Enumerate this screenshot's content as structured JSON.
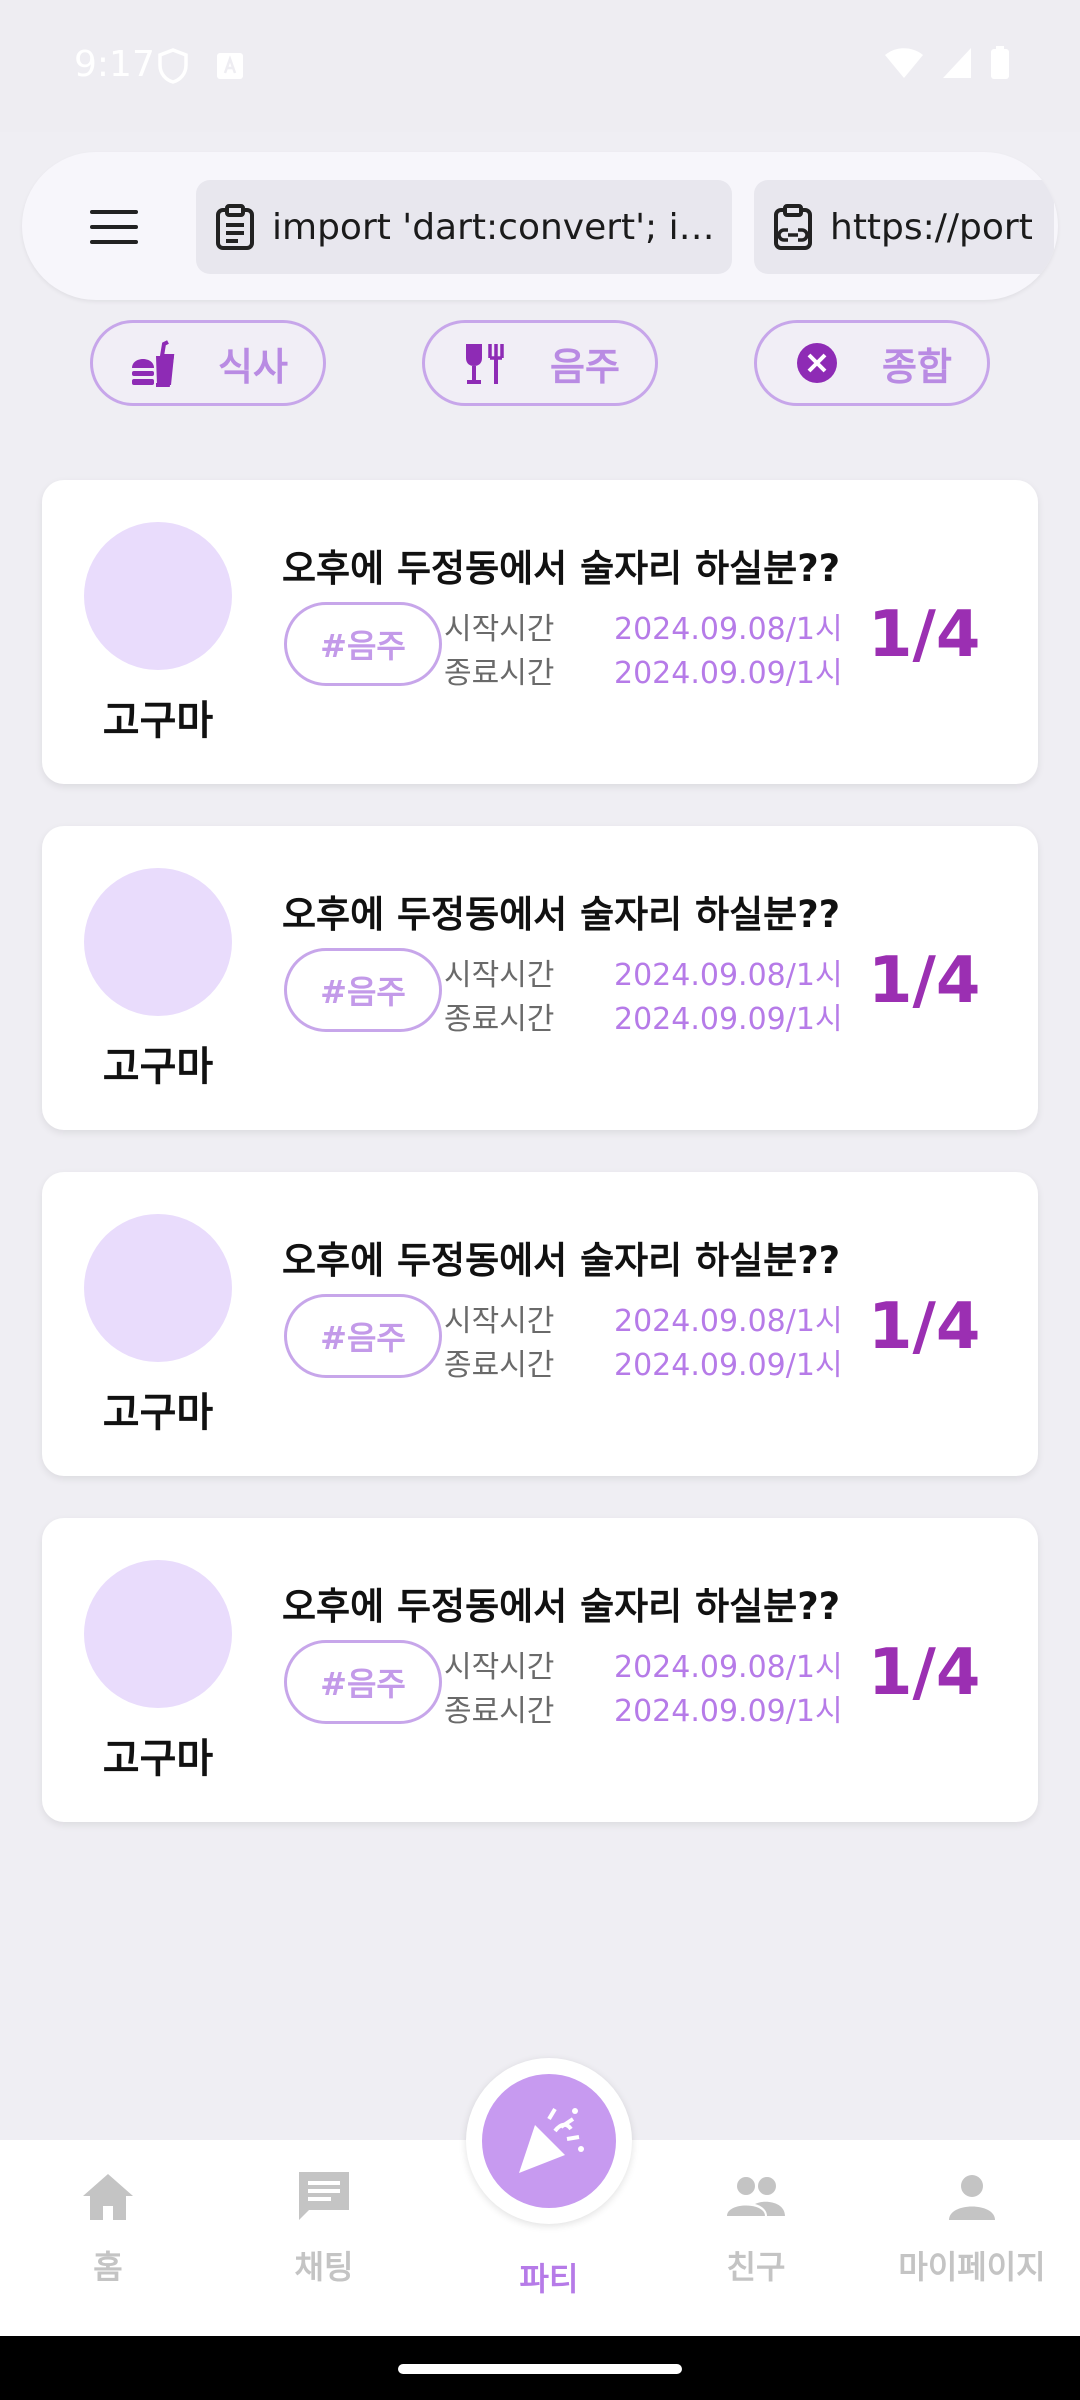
{
  "status_bar": {
    "time": "9:17"
  },
  "url_bar": {
    "clipboard_chip_1": "import 'dart:convert'; i…",
    "clipboard_chip_2": "https://port"
  },
  "categories": [
    {
      "label": "식사",
      "icon": "fastfood-icon"
    },
    {
      "label": "음주",
      "icon": "bar-icon"
    },
    {
      "label": "종합",
      "icon": "mixed-icon"
    }
  ],
  "parties": [
    {
      "host": "고구마",
      "title": "오후에 두정동에서 술자리 하실분??",
      "tag": "#음주",
      "start_label": "시작시간",
      "start_value": "2024.09.08/1시",
      "end_label": "종료시간",
      "end_value": "2024.09.09/1시",
      "count": "1/4"
    },
    {
      "host": "고구마",
      "title": "오후에 두정동에서 술자리 하실분??",
      "tag": "#음주",
      "start_label": "시작시간",
      "start_value": "2024.09.08/1시",
      "end_label": "종료시간",
      "end_value": "2024.09.09/1시",
      "count": "1/4"
    },
    {
      "host": "고구마",
      "title": "오후에 두정동에서 술자리 하실분??",
      "tag": "#음주",
      "start_label": "시작시간",
      "start_value": "2024.09.08/1시",
      "end_label": "종료시간",
      "end_value": "2024.09.09/1시",
      "count": "1/4"
    },
    {
      "host": "고구마",
      "title": "오후에 두정동에서 술자리 하실분??",
      "tag": "#음주",
      "start_label": "시작시간",
      "start_value": "2024.09.08/1시",
      "end_label": "종료시간",
      "end_value": "2024.09.09/1시",
      "count": "1/4"
    }
  ],
  "bottom_nav": {
    "home": "홈",
    "chat": "채팅",
    "party": "파티",
    "friends": "친구",
    "mypage": "마이페이지"
  },
  "colors": {
    "accent": "#b67be8",
    "count": "#9b2fb2",
    "avatar": "#e9dcfc"
  }
}
